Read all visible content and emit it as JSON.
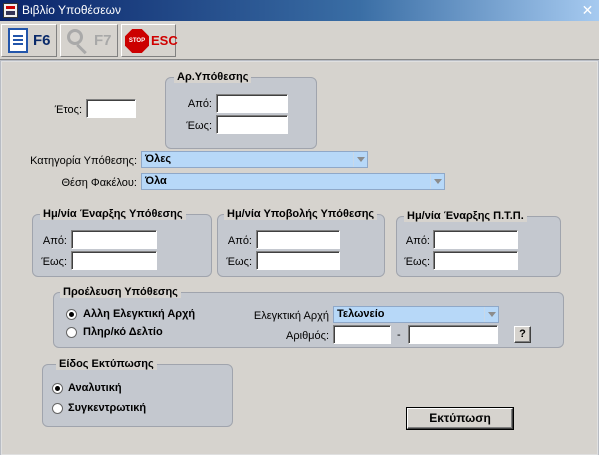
{
  "window": {
    "title": "Βιβλίο Υποθέσεων",
    "close_glyph": "✕"
  },
  "toolbar": {
    "f6_label": "F6",
    "f7_label": "F7",
    "stop_text": "STOP",
    "esc_label": "ESC"
  },
  "form": {
    "year_label": "Έτος:",
    "year_value": "",
    "case_no_group": {
      "title": "Αρ.Υπόθεσης",
      "from_label": "Από:",
      "to_label": "Έως:",
      "from_value": "",
      "to_value": ""
    },
    "category_label": "Κατηγορία Υπόθεσης:",
    "category_value": "Όλες",
    "folder_label": "Θέση Φακέλου:",
    "folder_value": "Όλα",
    "start_date_group": {
      "title": "Ημ/νία Έναρξης Υπόθεσης",
      "from_label": "Από:",
      "to_label": "Έως:",
      "from_value": "",
      "to_value": ""
    },
    "submit_date_group": {
      "title": "Ημ/νία Υποβολής Υπόθεσης",
      "from_label": "Από:",
      "to_label": "Έως:",
      "from_value": "",
      "to_value": ""
    },
    "ptp_date_group": {
      "title": "Ημ/νία Έναρξης Π.Τ.Π.",
      "from_label": "Από:",
      "to_label": "Έως:",
      "from_value": "",
      "to_value": ""
    },
    "origin_group": {
      "title": "Προέλευση Υπόθεσης",
      "options": [
        "Αλλη Ελεγκτική Αρχή",
        "Πληρ/κό Δελτίο"
      ],
      "selected": 0,
      "authority_label": "Ελεγκτική Αρχή",
      "authority_value": "Τελωνείο",
      "number_label": "Αριθμός:",
      "number_value_1": "",
      "number_separator": "-",
      "number_value_2": "",
      "help_label": "?"
    },
    "print_type_group": {
      "title": "Είδος Εκτύπωσης",
      "options": [
        "Αναλυτική",
        "Συγκεντρωτική"
      ],
      "selected": 0
    },
    "print_button": "Εκτύπωση"
  }
}
